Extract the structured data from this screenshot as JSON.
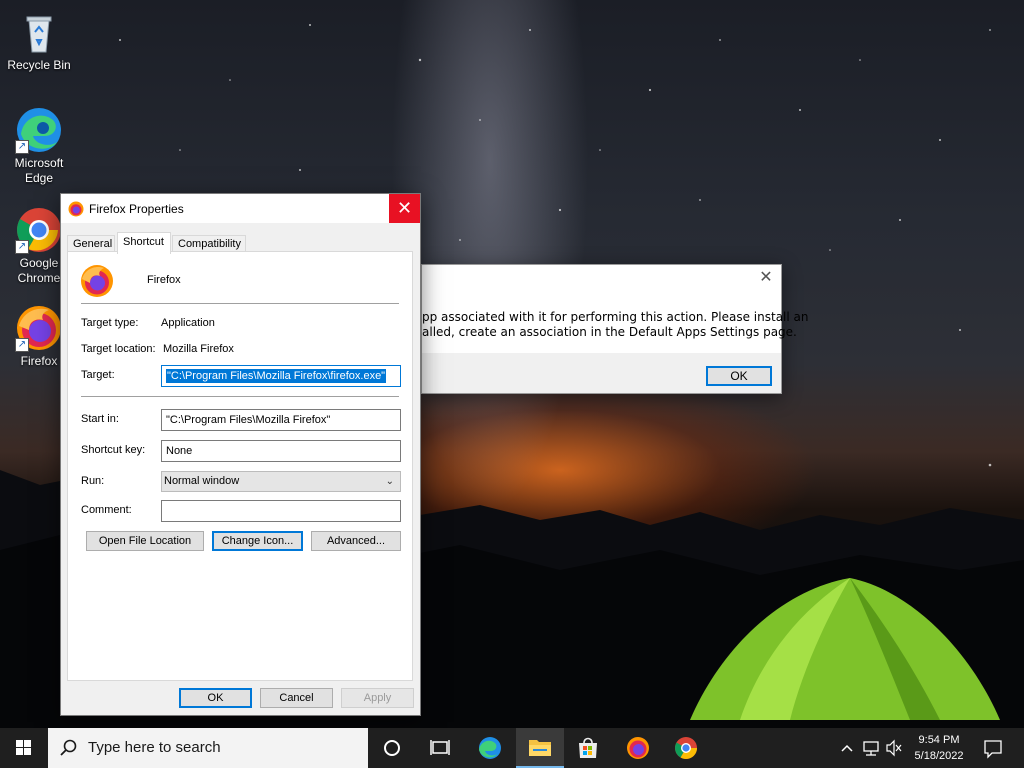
{
  "desktop": {
    "icons": [
      {
        "label": "Recycle Bin",
        "icon": "recycle-bin-icon"
      },
      {
        "label": "Microsoft\nEdge",
        "icon": "edge-icon"
      },
      {
        "label": "Google\nChrome",
        "icon": "chrome-icon"
      },
      {
        "label": "Firefox",
        "icon": "firefox-icon"
      }
    ]
  },
  "message_dialog": {
    "text": "pp associated with it for performing this action. Please install an\nalled, create an association in the Default Apps Settings page.",
    "ok_label": "OK"
  },
  "properties_dialog": {
    "title": "Firefox Properties",
    "tabs": [
      "General",
      "Shortcut",
      "Compatibility"
    ],
    "active_tab": "Shortcut",
    "app_name": "Firefox",
    "target_type_label": "Target type:",
    "target_type_value": "Application",
    "target_location_label": "Target location:",
    "target_location_value": "Mozilla Firefox",
    "target_label": "Target:",
    "target_value": "\"C:\\Program Files\\Mozilla Firefox\\firefox.exe\"",
    "start_in_label": "Start in:",
    "start_in_value": "\"C:\\Program Files\\Mozilla Firefox\"",
    "shortcut_key_label": "Shortcut key:",
    "shortcut_key_value": "None",
    "run_label": "Run:",
    "run_value": "Normal window",
    "comment_label": "Comment:",
    "comment_value": "",
    "buttons": {
      "open_file_location": "Open File Location",
      "change_icon": "Change Icon...",
      "advanced": "Advanced...",
      "ok": "OK",
      "cancel": "Cancel",
      "apply": "Apply"
    }
  },
  "taskbar": {
    "search_placeholder": "Type here to search",
    "time": "9:54 PM",
    "date": "5/18/2022",
    "apps": [
      "task-view-icon",
      "edge-icon",
      "file-explorer-icon",
      "store-icon",
      "firefox-icon",
      "chrome-icon"
    ],
    "active_app": "file-explorer-icon"
  },
  "colors": {
    "accent": "#0078d7",
    "close_red": "#e81123",
    "taskbar": "#1f1f1f"
  }
}
